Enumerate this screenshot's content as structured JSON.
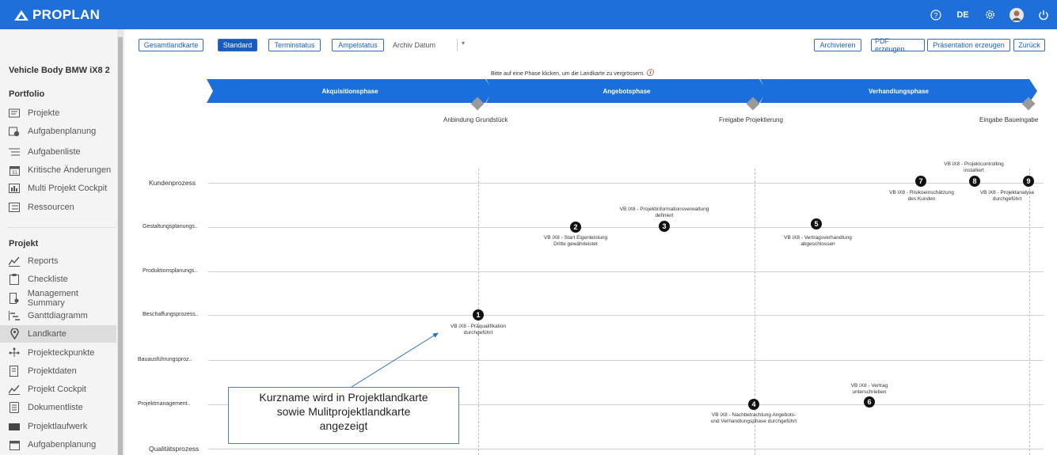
{
  "header": {
    "logo_text": "PROPLAN",
    "lang": "DE",
    "icons": [
      "help-icon",
      "gear-icon",
      "avatar",
      "power-icon"
    ]
  },
  "sidebar": {
    "project_name": "Vehicle Body BMW iX8 2",
    "portfolio_title": "Portfolio",
    "portfolio_items": [
      {
        "label": "Projekte",
        "icon": "projects-icon"
      },
      {
        "label": "Aufgabenplanung",
        "icon": "task-planning-icon"
      },
      {
        "label": "Aufgabenliste",
        "icon": "task-list-icon"
      },
      {
        "label": "Kritische Änderungen",
        "icon": "calendar-icon"
      },
      {
        "label": "Multi Projekt Cockpit",
        "icon": "cockpit-icon"
      },
      {
        "label": "Ressourcen",
        "icon": "resources-icon"
      }
    ],
    "project_title": "Projekt",
    "project_items": [
      {
        "label": "Reports",
        "icon": "reports-icon"
      },
      {
        "label": "Checkliste",
        "icon": "checklist-icon"
      },
      {
        "label": "Management Summary",
        "icon": "summary-icon"
      },
      {
        "label": "Ganttdiagramm",
        "icon": "gantt-icon"
      },
      {
        "label": "Landkarte",
        "icon": "map-pin-icon"
      },
      {
        "label": "Projekteckpunkte",
        "icon": "milestones-icon"
      },
      {
        "label": "Projektdaten",
        "icon": "project-data-icon"
      },
      {
        "label": "Projekt Cockpit",
        "icon": "project-cockpit-icon"
      },
      {
        "label": "Dokumentliste",
        "icon": "document-list-icon"
      },
      {
        "label": "Projektlaufwerk",
        "icon": "drive-icon"
      },
      {
        "label": "Aufgabenplanung",
        "icon": "task-planning-icon"
      }
    ],
    "active_item": "Landkarte"
  },
  "toolbar": {
    "gesamt": "Gesamtlandkarte",
    "standard": "Standard",
    "terminstatus": "Terminstatus",
    "ampelstatus": "Ampelstatus",
    "archiv_label": "Archiv Datum",
    "archivieren": "Archivieren",
    "pdf": "PDF erzeugen",
    "praesentation": "Präsentation erzeugen",
    "zurueck": "Zurück"
  },
  "map": {
    "hint": "Bitte auf eine Phase klicken, um die Landkarte zu vergrössern.",
    "phases": [
      "Akquisitionsphase",
      "Angebotsphase",
      "Verhandlungsphase"
    ],
    "milestones": [
      "Anbindung Grundstück",
      "Freigabe Projektierung",
      "Eingabe Baueingabe"
    ],
    "lanes": [
      "Kundenprozess",
      "Gestaltungsplanungs..",
      "Produktionsplanungs..",
      "Beschaffungsprozess..",
      "Bauausführungsproz..",
      "Projektmanagement..",
      "Qualitätsprozess"
    ],
    "events": [
      {
        "num": "1",
        "line1": "VB iX8 - Präqualifikation",
        "line2": "durchgeführt"
      },
      {
        "num": "2",
        "line1": "VB iX8 - Start Eigenleistung",
        "line2": "Dritte gewährleistet"
      },
      {
        "num": "3",
        "line1": "VB iX8 - Projektinformationsverwaltung",
        "line2": "definiert"
      },
      {
        "num": "4",
        "line1": "VB iX8 - Nachbetrachtung Angebots-",
        "line2": "und Verhandlungsphase durchgeführt"
      },
      {
        "num": "5",
        "line1": "VB iX8 - Vertragsverhandlung",
        "line2": "abgeschlossen"
      },
      {
        "num": "6",
        "line1": "VB iX8 - Vertrag",
        "line2": "unterschrieben"
      },
      {
        "num": "7",
        "line1": "VB iX8 - Risikoeinschätzung",
        "line2": "des Kunden"
      },
      {
        "num": "8",
        "line1": "VB iX8 - Projektcontrolling",
        "line2": "installiert"
      },
      {
        "num": "9",
        "line1": "VB iX8 - Projektanalyse",
        "line2": "durchgeführt"
      }
    ]
  },
  "callout": {
    "line1": "Kurzname wird in Projektlandkarte",
    "line2": "sowie Mulitprojektlandkarte",
    "line3": "angezeigt"
  },
  "colors": {
    "brand": "#1e6fd9",
    "phase": "#1a6fdc"
  }
}
